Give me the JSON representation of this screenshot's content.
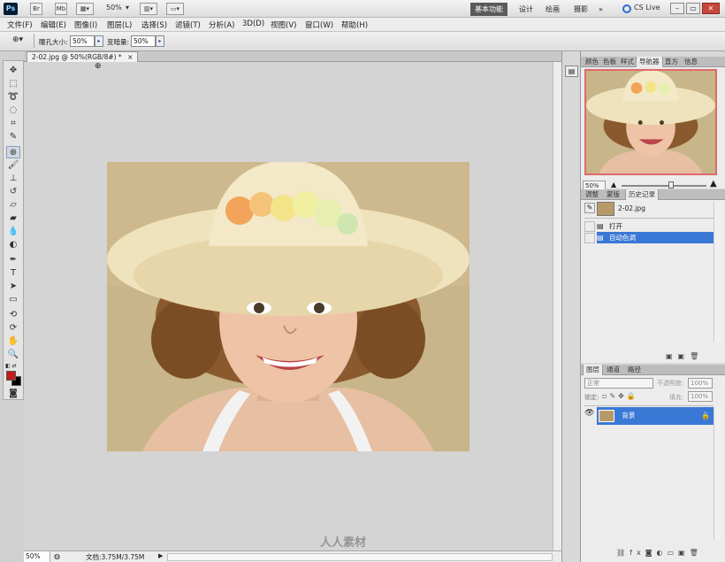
{
  "app": {
    "logo": "Ps",
    "bridge_label": "Br",
    "minibridge_label": "Mb",
    "zoom_label": "50%",
    "workspaces": [
      "基本功能",
      "设计",
      "绘画",
      "摄影"
    ],
    "more_label": "»",
    "cslive_label": "CS Live",
    "window_controls": [
      "–",
      "▭",
      "✕"
    ]
  },
  "menus": [
    "文件(F)",
    "编辑(E)",
    "图像(I)",
    "图层(L)",
    "选择(S)",
    "滤镜(T)",
    "分析(A)",
    "3D(D)",
    "视图(V)",
    "窗口(W)",
    "帮助(H)"
  ],
  "options": {
    "pupil_label": "瞳孔大小:",
    "pupil_value": "50%",
    "darken_label": "变暗量:",
    "darken_value": "50%"
  },
  "document": {
    "tab_title": "2-02.jpg @ 50%(RGB/8#) *",
    "tab_close": "×"
  },
  "status": {
    "zoom": "50%",
    "doc_info": "文档:3.75M/3.75M"
  },
  "navigator": {
    "tabs": [
      "颜色",
      "色板",
      "样式",
      "导航器",
      "直方",
      "信息"
    ],
    "active_tab": "导航器",
    "zoom": "50%"
  },
  "history": {
    "tabs": [
      "调整",
      "蒙版",
      "历史记录"
    ],
    "snapshot": "2-02.jpg",
    "steps": [
      {
        "label": "打开",
        "selected": false
      },
      {
        "label": "自动色调",
        "selected": true
      }
    ]
  },
  "layers": {
    "tabs": [
      "图层",
      "通道",
      "路径"
    ],
    "blend_mode": "正常",
    "opacity_label": "不透明度:",
    "opacity_value": "100%",
    "lock_label": "锁定:",
    "fill_label": "填充:",
    "fill_value": "100%",
    "items": [
      {
        "name": "背景",
        "selected": true
      }
    ]
  },
  "watermark": "人人素材",
  "colors": {
    "foreground": "#c41a1a",
    "background": "#000000",
    "selection": "#3a78d6"
  }
}
